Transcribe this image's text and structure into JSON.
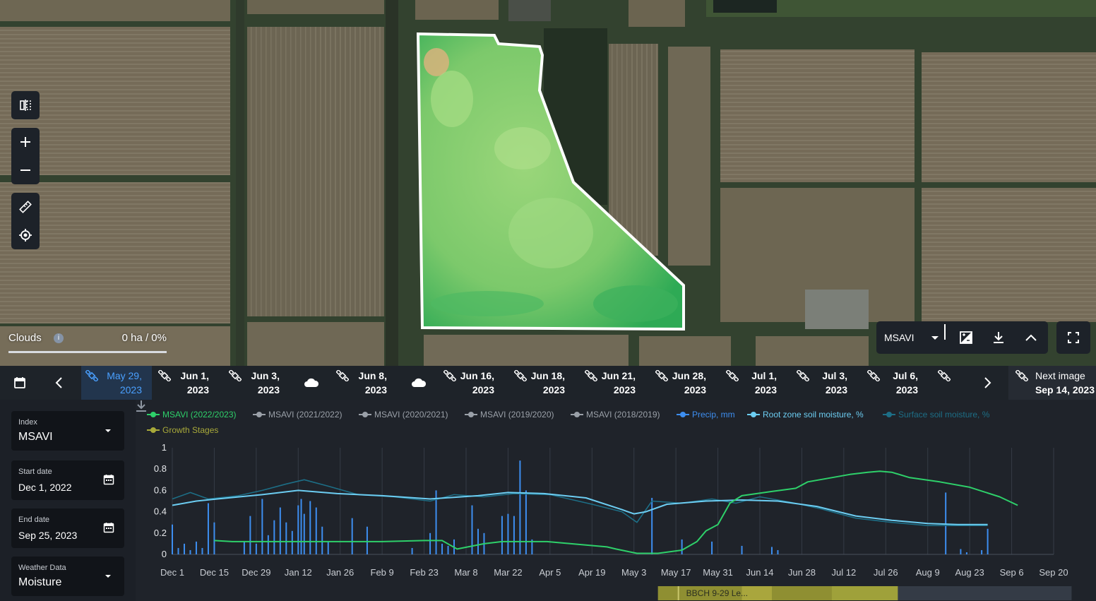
{
  "map": {
    "clouds": {
      "label": "Clouds",
      "info_icon": "info-icon",
      "value": "0 ha / 0%"
    },
    "controls": [
      "split-view-icon",
      "zoom-in-icon",
      "zoom-out-icon",
      "ruler-icon",
      "locate-icon"
    ],
    "layer": {
      "selected": "MSAVI",
      "buttons": [
        "image-compare-icon",
        "download-icon",
        "chevron-up-icon"
      ]
    },
    "fullscreen_icon": "fullscreen-icon"
  },
  "timeline": {
    "items": [
      {
        "line1": "May 29,",
        "line2": "2023",
        "active": true
      },
      {
        "line1": "Jun 1,",
        "line2": "2023"
      },
      {
        "line1": "Jun 3,",
        "line2": "2023"
      },
      {
        "line1": "Jun 8,",
        "line2": "2023"
      },
      {
        "line1": "Jun 16,",
        "line2": "2023"
      },
      {
        "line1": "Jun 18,",
        "line2": "2023"
      },
      {
        "line1": "Jun 21,",
        "line2": "2023"
      },
      {
        "line1": "Jun 28,",
        "line2": "2023"
      },
      {
        "line1": "Jul 1,",
        "line2": "2023"
      },
      {
        "line1": "Jul 3,",
        "line2": "2023"
      },
      {
        "line1": "Jul 6,",
        "line2": "2023"
      }
    ],
    "next_image": {
      "line1": "Next image",
      "line2": "Sep 14, 2023"
    }
  },
  "sidebar": {
    "index": {
      "label": "Index",
      "value": "MSAVI"
    },
    "start_date": {
      "label": "Start date",
      "value": "Dec 1, 2022"
    },
    "end_date": {
      "label": "End date",
      "value": "Sep 25, 2023"
    },
    "weather": {
      "label": "Weather Data",
      "value": "Moisture"
    }
  },
  "chart_data": {
    "type": "line",
    "legend": [
      {
        "name": "MSAVI (2022/2023)",
        "color": "#2ed06a"
      },
      {
        "name": "MSAVI (2021/2022)",
        "color": "#9aa0a8"
      },
      {
        "name": "MSAVI (2020/2021)",
        "color": "#9aa0a8"
      },
      {
        "name": "MSAVI (2019/2020)",
        "color": "#9aa0a8"
      },
      {
        "name": "MSAVI (2018/2019)",
        "color": "#9aa0a8"
      },
      {
        "name": "Precip, mm",
        "color": "#3d8ef0"
      },
      {
        "name": "Root zone soil moisture, %",
        "color": "#6ccdf2"
      },
      {
        "name": "Surface soil moisture, %",
        "color": "#1d6e86"
      },
      {
        "name": "Growth Stages",
        "color": "#a8a93a"
      }
    ],
    "x_ticks": [
      "Dec 1",
      "Dec 15",
      "Dec 29",
      "Jan 12",
      "Jan 26",
      "Feb 9",
      "Feb 23",
      "Mar 8",
      "Mar 22",
      "Apr 5",
      "Apr 19",
      "May 3",
      "May 17",
      "May 31",
      "Jun 14",
      "Jun 28",
      "Jul 12",
      "Jul 26",
      "Aug 9",
      "Aug 23",
      "Sep 6",
      "Sep 20"
    ],
    "y_ticks": [
      "1",
      "0.8",
      "0.6",
      "0.4",
      "0.2",
      "0"
    ],
    "ylim": [
      0,
      1
    ],
    "msavi_2022_2023": [
      [
        0,
        null
      ],
      [
        14,
        0.13
      ],
      [
        20,
        0.12
      ],
      [
        40,
        0.12
      ],
      [
        70,
        0.12
      ],
      [
        84,
        0.13
      ],
      [
        90,
        0.13
      ],
      [
        95,
        0.05
      ],
      [
        104,
        0.1
      ],
      [
        110,
        0.12
      ],
      [
        125,
        0.12
      ],
      [
        145,
        0.07
      ],
      [
        148,
        0.05
      ],
      [
        155,
        0.01
      ],
      [
        162,
        0.01
      ],
      [
        170,
        0.04
      ],
      [
        175,
        0.12
      ],
      [
        178,
        0.22
      ],
      [
        182,
        0.28
      ],
      [
        186,
        0.48
      ],
      [
        190,
        0.55
      ],
      [
        195,
        0.57
      ],
      [
        200,
        0.59
      ],
      [
        208,
        0.62
      ],
      [
        212,
        0.68
      ],
      [
        220,
        0.72
      ],
      [
        226,
        0.75
      ],
      [
        232,
        0.77
      ],
      [
        236,
        0.78
      ],
      [
        240,
        0.77
      ],
      [
        246,
        0.72
      ],
      [
        256,
        0.68
      ],
      [
        266,
        0.63
      ],
      [
        276,
        0.54
      ],
      [
        282,
        0.46
      ]
    ],
    "root_zone_soil_moisture": [
      [
        0,
        0.46
      ],
      [
        8,
        0.5
      ],
      [
        15,
        0.52
      ],
      [
        30,
        0.56
      ],
      [
        42,
        0.6
      ],
      [
        55,
        0.57
      ],
      [
        70,
        0.55
      ],
      [
        86,
        0.52
      ],
      [
        102,
        0.55
      ],
      [
        112,
        0.58
      ],
      [
        124,
        0.57
      ],
      [
        138,
        0.53
      ],
      [
        150,
        0.42
      ],
      [
        154,
        0.38
      ],
      [
        158,
        0.4
      ],
      [
        165,
        0.47
      ],
      [
        178,
        0.5
      ],
      [
        190,
        0.51
      ],
      [
        202,
        0.5
      ],
      [
        215,
        0.45
      ],
      [
        228,
        0.36
      ],
      [
        240,
        0.32
      ],
      [
        252,
        0.29
      ],
      [
        262,
        0.28
      ],
      [
        272,
        0.28
      ]
    ],
    "surface_soil_moisture": [
      [
        0,
        0.52
      ],
      [
        6,
        0.58
      ],
      [
        12,
        0.52
      ],
      [
        22,
        0.55
      ],
      [
        30,
        0.6
      ],
      [
        38,
        0.66
      ],
      [
        44,
        0.7
      ],
      [
        52,
        0.64
      ],
      [
        62,
        0.56
      ],
      [
        74,
        0.54
      ],
      [
        86,
        0.5
      ],
      [
        94,
        0.56
      ],
      [
        104,
        0.54
      ],
      [
        114,
        0.57
      ],
      [
        126,
        0.56
      ],
      [
        140,
        0.47
      ],
      [
        150,
        0.4
      ],
      [
        155,
        0.3
      ],
      [
        160,
        0.5
      ],
      [
        170,
        0.48
      ],
      [
        180,
        0.52
      ],
      [
        188,
        0.48
      ],
      [
        196,
        0.54
      ],
      [
        206,
        0.49
      ],
      [
        216,
        0.43
      ],
      [
        228,
        0.34
      ],
      [
        240,
        0.3
      ],
      [
        252,
        0.27
      ],
      [
        262,
        0.27
      ],
      [
        272,
        0.27
      ]
    ],
    "precip": [
      [
        0,
        0.28
      ],
      [
        2,
        0.06
      ],
      [
        4,
        0.1
      ],
      [
        6,
        0.04
      ],
      [
        8,
        0.12
      ],
      [
        10,
        0.06
      ],
      [
        12,
        0.48
      ],
      [
        14,
        0.3
      ],
      [
        24,
        0.12
      ],
      [
        26,
        0.36
      ],
      [
        28,
        0.1
      ],
      [
        30,
        0.52
      ],
      [
        32,
        0.18
      ],
      [
        34,
        0.32
      ],
      [
        36,
        0.44
      ],
      [
        38,
        0.3
      ],
      [
        40,
        0.22
      ],
      [
        42,
        0.46
      ],
      [
        43,
        0.52
      ],
      [
        44,
        0.38
      ],
      [
        46,
        0.5
      ],
      [
        48,
        0.44
      ],
      [
        50,
        0.26
      ],
      [
        52,
        0.12
      ],
      [
        60,
        0.34
      ],
      [
        65,
        0.26
      ],
      [
        80,
        0.06
      ],
      [
        86,
        0.2
      ],
      [
        88,
        0.6
      ],
      [
        90,
        0.1
      ],
      [
        92,
        0.08
      ],
      [
        94,
        0.14
      ],
      [
        100,
        0.46
      ],
      [
        102,
        0.24
      ],
      [
        104,
        0.2
      ],
      [
        110,
        0.36
      ],
      [
        112,
        0.38
      ],
      [
        114,
        0.36
      ],
      [
        116,
        0.88
      ],
      [
        118,
        0.6
      ],
      [
        120,
        0.14
      ],
      [
        160,
        0.53
      ],
      [
        170,
        0.14
      ],
      [
        180,
        0.12
      ],
      [
        190,
        0.08
      ],
      [
        200,
        0.07
      ],
      [
        202,
        0.04
      ],
      [
        258,
        0.58
      ],
      [
        263,
        0.05
      ],
      [
        265,
        0.02
      ],
      [
        270,
        0.04
      ],
      [
        272,
        0.24
      ]
    ],
    "growth_stage_label": "BBCH 9-29 Le..."
  }
}
